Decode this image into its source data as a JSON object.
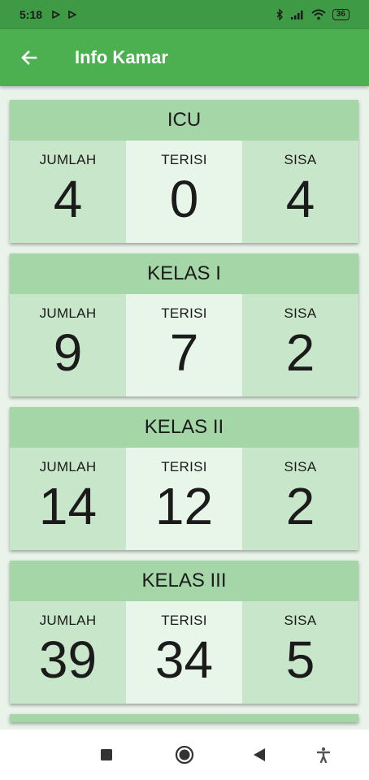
{
  "status_bar": {
    "time": "5:18",
    "battery": "36"
  },
  "app_bar": {
    "title": "Info Kamar",
    "back_icon": "arrow-left-icon"
  },
  "labels": {
    "total": "JUMLAH",
    "occupied": "TERISI",
    "remaining": "SISA"
  },
  "rooms": [
    {
      "name": "ICU",
      "total": "4",
      "occupied": "0",
      "remaining": "4"
    },
    {
      "name": "KELAS I",
      "total": "9",
      "occupied": "7",
      "remaining": "2"
    },
    {
      "name": "KELAS II",
      "total": "14",
      "occupied": "12",
      "remaining": "2"
    },
    {
      "name": "KELAS III",
      "total": "39",
      "occupied": "34",
      "remaining": "5"
    }
  ],
  "colors": {
    "status_bar": "#3f9a45",
    "app_bar": "#4caf50",
    "card_header": "#a5d6a7",
    "cell_side": "#c8e6c9",
    "cell_middle": "#e8f5e9",
    "background": "#e9f3ea"
  }
}
